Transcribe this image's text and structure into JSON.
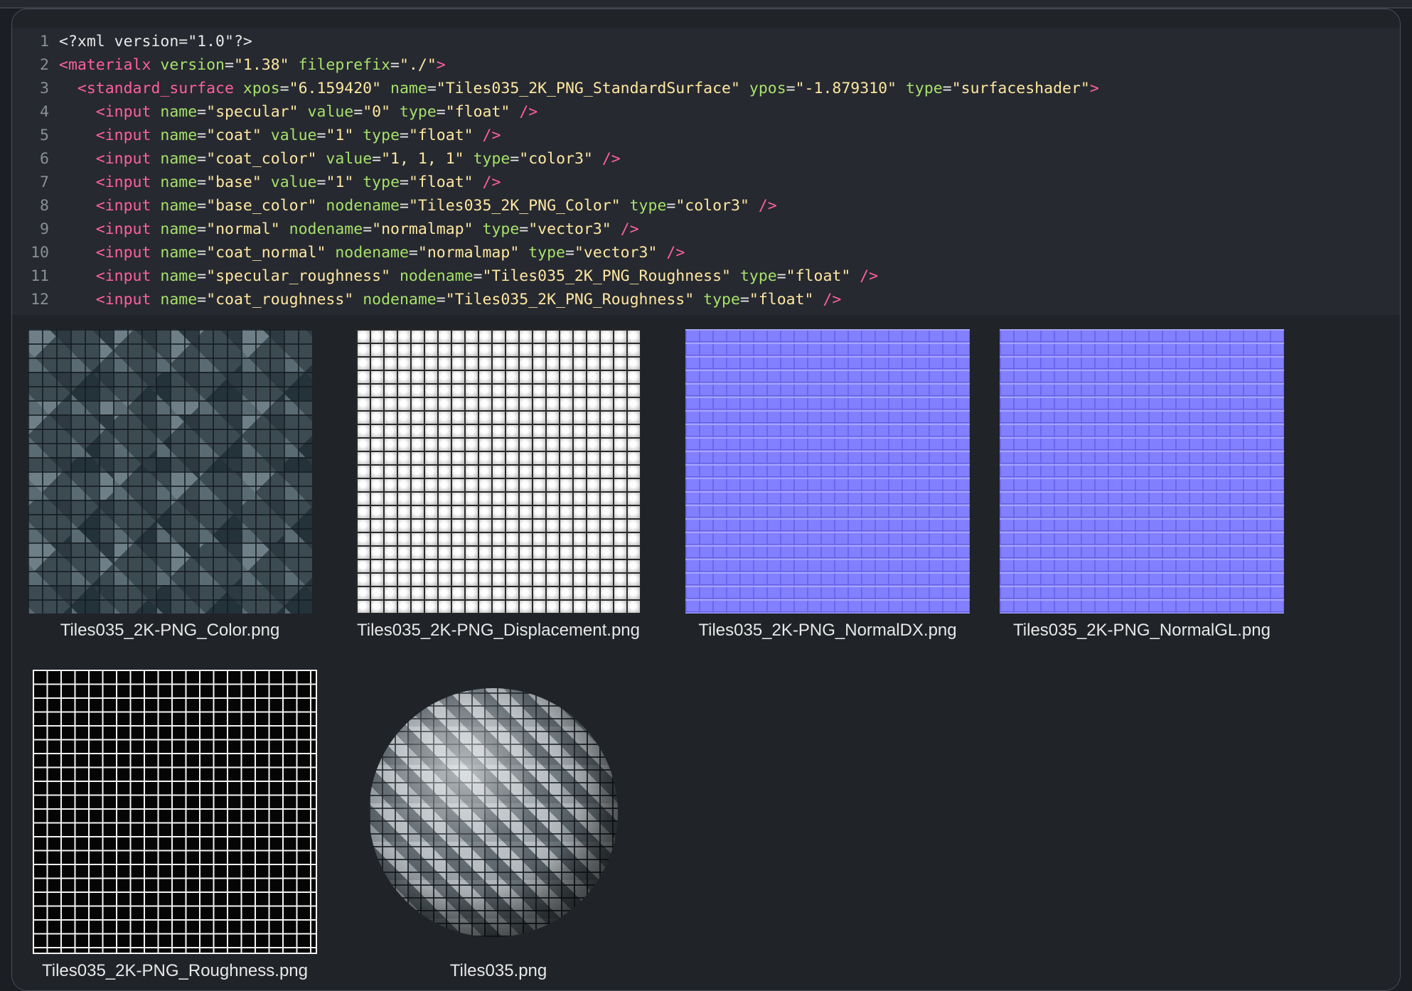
{
  "code": {
    "lines": [
      {
        "n": "1",
        "parts": [
          [
            "plain",
            "<?xml version=\"1.0\"?>"
          ]
        ]
      },
      {
        "n": "2",
        "parts": [
          [
            "tag",
            "<materialx "
          ],
          [
            "attr",
            "version"
          ],
          [
            "plain",
            "="
          ],
          [
            "str",
            "\"1.38\""
          ],
          [
            "plain",
            " "
          ],
          [
            "attr",
            "fileprefix"
          ],
          [
            "plain",
            "="
          ],
          [
            "str",
            "\"./\""
          ],
          [
            "tag",
            ">"
          ]
        ]
      },
      {
        "n": "3",
        "parts": [
          [
            "plain",
            "  "
          ],
          [
            "tag",
            "<standard_surface "
          ],
          [
            "attr",
            "xpos"
          ],
          [
            "plain",
            "="
          ],
          [
            "str",
            "\"6.159420\""
          ],
          [
            "plain",
            " "
          ],
          [
            "attr",
            "name"
          ],
          [
            "plain",
            "="
          ],
          [
            "str",
            "\"Tiles035_2K_PNG_StandardSurface\""
          ],
          [
            "plain",
            " "
          ],
          [
            "attr",
            "ypos"
          ],
          [
            "plain",
            "="
          ],
          [
            "str",
            "\"-1.879310\""
          ],
          [
            "plain",
            " "
          ],
          [
            "attr",
            "type"
          ],
          [
            "plain",
            "="
          ],
          [
            "str",
            "\"surfaceshader\""
          ],
          [
            "tag",
            ">"
          ]
        ]
      },
      {
        "n": "4",
        "parts": [
          [
            "plain",
            "    "
          ],
          [
            "tag",
            "<input "
          ],
          [
            "attr",
            "name"
          ],
          [
            "plain",
            "="
          ],
          [
            "str",
            "\"specular\""
          ],
          [
            "plain",
            " "
          ],
          [
            "attr",
            "value"
          ],
          [
            "plain",
            "="
          ],
          [
            "str",
            "\"0\""
          ],
          [
            "plain",
            " "
          ],
          [
            "attr",
            "type"
          ],
          [
            "plain",
            "="
          ],
          [
            "str",
            "\"float\""
          ],
          [
            "plain",
            " "
          ],
          [
            "tag",
            "/>"
          ]
        ]
      },
      {
        "n": "5",
        "parts": [
          [
            "plain",
            "    "
          ],
          [
            "tag",
            "<input "
          ],
          [
            "attr",
            "name"
          ],
          [
            "plain",
            "="
          ],
          [
            "str",
            "\"coat\""
          ],
          [
            "plain",
            " "
          ],
          [
            "attr",
            "value"
          ],
          [
            "plain",
            "="
          ],
          [
            "str",
            "\"1\""
          ],
          [
            "plain",
            " "
          ],
          [
            "attr",
            "type"
          ],
          [
            "plain",
            "="
          ],
          [
            "str",
            "\"float\""
          ],
          [
            "plain",
            " "
          ],
          [
            "tag",
            "/>"
          ]
        ]
      },
      {
        "n": "6",
        "parts": [
          [
            "plain",
            "    "
          ],
          [
            "tag",
            "<input "
          ],
          [
            "attr",
            "name"
          ],
          [
            "plain",
            "="
          ],
          [
            "str",
            "\"coat_color\""
          ],
          [
            "plain",
            " "
          ],
          [
            "attr",
            "value"
          ],
          [
            "plain",
            "="
          ],
          [
            "str",
            "\"1, 1, 1\""
          ],
          [
            "plain",
            " "
          ],
          [
            "attr",
            "type"
          ],
          [
            "plain",
            "="
          ],
          [
            "str",
            "\"color3\""
          ],
          [
            "plain",
            " "
          ],
          [
            "tag",
            "/>"
          ]
        ]
      },
      {
        "n": "7",
        "parts": [
          [
            "plain",
            "    "
          ],
          [
            "tag",
            "<input "
          ],
          [
            "attr",
            "name"
          ],
          [
            "plain",
            "="
          ],
          [
            "str",
            "\"base\""
          ],
          [
            "plain",
            " "
          ],
          [
            "attr",
            "value"
          ],
          [
            "plain",
            "="
          ],
          [
            "str",
            "\"1\""
          ],
          [
            "plain",
            " "
          ],
          [
            "attr",
            "type"
          ],
          [
            "plain",
            "="
          ],
          [
            "str",
            "\"float\""
          ],
          [
            "plain",
            " "
          ],
          [
            "tag",
            "/>"
          ]
        ]
      },
      {
        "n": "8",
        "parts": [
          [
            "plain",
            "    "
          ],
          [
            "tag",
            "<input "
          ],
          [
            "attr",
            "name"
          ],
          [
            "plain",
            "="
          ],
          [
            "str",
            "\"base_color\""
          ],
          [
            "plain",
            " "
          ],
          [
            "attr",
            "nodename"
          ],
          [
            "plain",
            "="
          ],
          [
            "str",
            "\"Tiles035_2K_PNG_Color\""
          ],
          [
            "plain",
            " "
          ],
          [
            "attr",
            "type"
          ],
          [
            "plain",
            "="
          ],
          [
            "str",
            "\"color3\""
          ],
          [
            "plain",
            " "
          ],
          [
            "tag",
            "/>"
          ]
        ]
      },
      {
        "n": "9",
        "parts": [
          [
            "plain",
            "    "
          ],
          [
            "tag",
            "<input "
          ],
          [
            "attr",
            "name"
          ],
          [
            "plain",
            "="
          ],
          [
            "str",
            "\"normal\""
          ],
          [
            "plain",
            " "
          ],
          [
            "attr",
            "nodename"
          ],
          [
            "plain",
            "="
          ],
          [
            "str",
            "\"normalmap\""
          ],
          [
            "plain",
            " "
          ],
          [
            "attr",
            "type"
          ],
          [
            "plain",
            "="
          ],
          [
            "str",
            "\"vector3\""
          ],
          [
            "plain",
            " "
          ],
          [
            "tag",
            "/>"
          ]
        ]
      },
      {
        "n": "10",
        "parts": [
          [
            "plain",
            "    "
          ],
          [
            "tag",
            "<input "
          ],
          [
            "attr",
            "name"
          ],
          [
            "plain",
            "="
          ],
          [
            "str",
            "\"coat_normal\""
          ],
          [
            "plain",
            " "
          ],
          [
            "attr",
            "nodename"
          ],
          [
            "plain",
            "="
          ],
          [
            "str",
            "\"normalmap\""
          ],
          [
            "plain",
            " "
          ],
          [
            "attr",
            "type"
          ],
          [
            "plain",
            "="
          ],
          [
            "str",
            "\"vector3\""
          ],
          [
            "plain",
            " "
          ],
          [
            "tag",
            "/>"
          ]
        ]
      },
      {
        "n": "11",
        "parts": [
          [
            "plain",
            "    "
          ],
          [
            "tag",
            "<input "
          ],
          [
            "attr",
            "name"
          ],
          [
            "plain",
            "="
          ],
          [
            "str",
            "\"specular_roughness\""
          ],
          [
            "plain",
            " "
          ],
          [
            "attr",
            "nodename"
          ],
          [
            "plain",
            "="
          ],
          [
            "str",
            "\"Tiles035_2K_PNG_Roughness\""
          ],
          [
            "plain",
            " "
          ],
          [
            "attr",
            "type"
          ],
          [
            "plain",
            "="
          ],
          [
            "str",
            "\"float\""
          ],
          [
            "plain",
            " "
          ],
          [
            "tag",
            "/>"
          ]
        ]
      },
      {
        "n": "12",
        "parts": [
          [
            "plain",
            "    "
          ],
          [
            "tag",
            "<input "
          ],
          [
            "attr",
            "name"
          ],
          [
            "plain",
            "="
          ],
          [
            "str",
            "\"coat_roughness\""
          ],
          [
            "plain",
            " "
          ],
          [
            "attr",
            "nodename"
          ],
          [
            "plain",
            "="
          ],
          [
            "str",
            "\"Tiles035_2K_PNG_Roughness\""
          ],
          [
            "plain",
            " "
          ],
          [
            "attr",
            "type"
          ],
          [
            "plain",
            "="
          ],
          [
            "str",
            "\"float\""
          ],
          [
            "plain",
            " "
          ],
          [
            "tag",
            "/>"
          ]
        ]
      }
    ]
  },
  "gallery": {
    "color": "Tiles035_2K-PNG_Color.png",
    "displacement": "Tiles035_2K-PNG_Displacement.png",
    "normal_dx": "Tiles035_2K-PNG_NormalDX.png",
    "normal_gl": "Tiles035_2K-PNG_NormalGL.png",
    "roughness": "Tiles035_2K-PNG_Roughness.png",
    "preview": "Tiles035.png"
  },
  "colors": {
    "tag": "#ff5fa2",
    "attr": "#a6e16a",
    "string": "#ffe7a1",
    "normal_map": "#8380ff"
  }
}
